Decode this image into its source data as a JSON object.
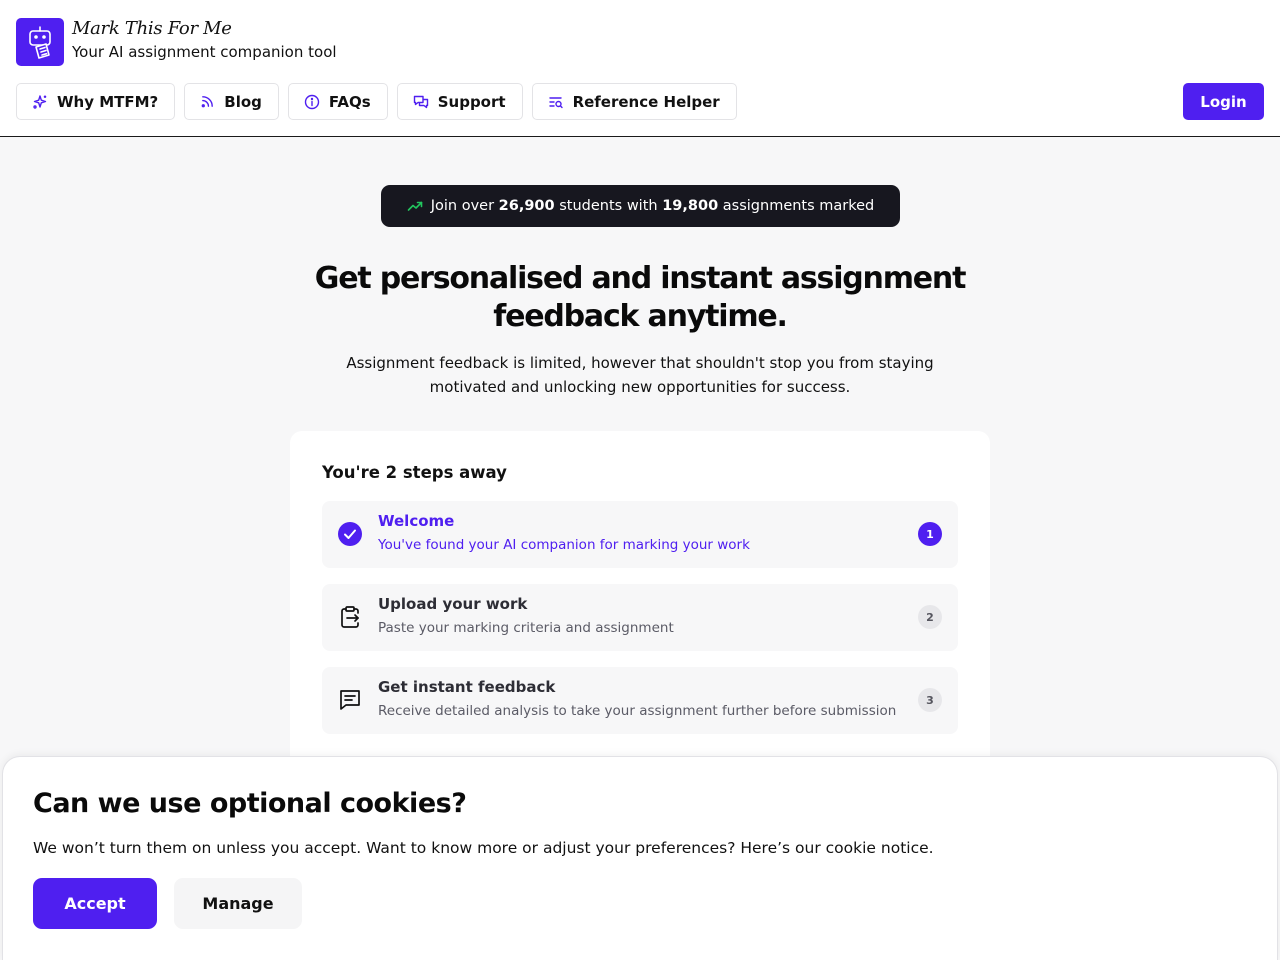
{
  "brand": {
    "name": "Mark This For Me",
    "tagline": "Your AI assignment companion tool"
  },
  "nav": {
    "items": [
      {
        "label": "Why MTFM?",
        "icon": "sparkles-icon"
      },
      {
        "label": "Blog",
        "icon": "rss-icon"
      },
      {
        "label": "FAQs",
        "icon": "info-icon"
      },
      {
        "label": "Support",
        "icon": "chat-bubbles-icon"
      },
      {
        "label": "Reference Helper",
        "icon": "list-search-icon"
      }
    ],
    "login_label": "Login"
  },
  "stats": {
    "prefix": "Join over",
    "students": "26,900",
    "middle": "students with",
    "assignments": "19,800",
    "suffix": "assignments marked"
  },
  "hero": {
    "title": "Get personalised and instant assignment feedback anytime.",
    "subtitle": "Assignment feedback is limited, however that shouldn't stop you from staying motivated and unlocking new opportunities for success."
  },
  "steps_card": {
    "title": "You're 2 steps away",
    "steps": [
      {
        "title": "Welcome",
        "desc": "You've found your AI companion for marking your work",
        "number": "1",
        "icon": "check-circle-icon",
        "active": true
      },
      {
        "title": "Upload your work",
        "desc": "Paste your marking criteria and assignment",
        "number": "2",
        "icon": "clipboard-upload-icon",
        "active": false
      },
      {
        "title": "Get instant feedback",
        "desc": "Receive detailed analysis to take your assignment further before submission",
        "number": "3",
        "icon": "message-lines-icon",
        "active": false
      }
    ]
  },
  "cookie": {
    "title": "Can we use optional cookies?",
    "text": "We won’t turn them on unless you accept. Want to know more or adjust your preferences? Here’s our cookie notice.",
    "accept_label": "Accept",
    "manage_label": "Manage"
  },
  "colors": {
    "accent": "#4f1ff0",
    "dark_pill": "#17171f",
    "trend_green": "#22c55e"
  }
}
